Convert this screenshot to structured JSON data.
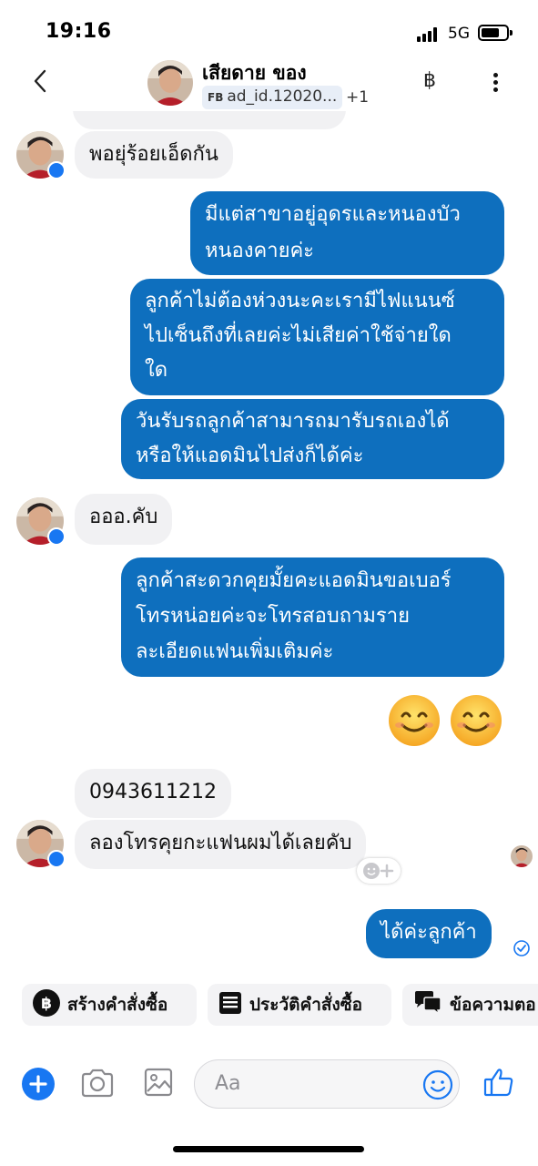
{
  "status_bar": {
    "time": "19:16",
    "network": "5G"
  },
  "header": {
    "contact_name": "เสียดาย ของ",
    "tag_prefix": "FB",
    "tag_text": "ad_id.12020...",
    "extra_count": "+1",
    "currency_symbol": "฿"
  },
  "messages": {
    "m1": "พอยุ่ร้อยเอ็ดกัน",
    "m2_l1": "มีแต่สาขาอยู่อุดรและหนองบัว",
    "m2_l2": "หนองคายค่ะ",
    "m3_l1": "ลูกค้าไม่ต้องห่วงนะคะเรามีไฟแนนซ์",
    "m3_l2": "ไปเซ็นถึงที่เลยค่ะไม่เสียค่าใช้จ่ายใด",
    "m3_l3": "ใด",
    "m4_l1": "วันรับรถลูกค้าสามารถมารับรถเองได้",
    "m4_l2": "หรือให้แอดมินไปส่งก็ได้ค่ะ",
    "m5": "อออ.คับ",
    "m6_l1": "ลูกค้าสะดวกคุยมั้ยคะแอดมินขอเบอร์",
    "m6_l2": "โทรหน่อยค่ะจะโทรสอบถามราย",
    "m6_l3": "ละเอียดแฟนเพิ่มเติมค่ะ",
    "m7": "0943611212",
    "m8": "ลองโทรคุยกะแฟนผมได้เลยคับ",
    "m9": "ได้ค่ะลูกค้า"
  },
  "quick_actions": {
    "create_order": "สร้างคำสั่งซื้อ",
    "order_history": "ประวัติคำสั่งซื้อ",
    "saved_replies": "ข้อความตอ"
  },
  "composer": {
    "placeholder": "Aa"
  },
  "colors": {
    "outgoing_bubble": "#0e6fbe",
    "incoming_bubble": "#f1f1f3",
    "accent": "#1877f2"
  }
}
